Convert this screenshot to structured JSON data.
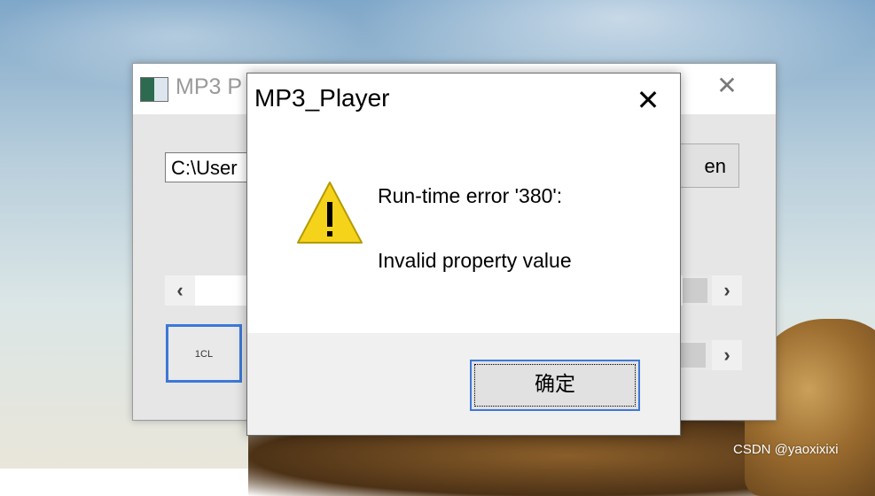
{
  "main_window": {
    "title": "MP3 P",
    "path_value": "C:\\User",
    "open_label": "en",
    "media_box_label": "1CL"
  },
  "dialog": {
    "title": "MP3_Player",
    "close_glyph": "✕",
    "message_line1": "Run-time error '380':",
    "message_line2": "Invalid property value",
    "ok_label": "确定",
    "icon": "warning-icon"
  },
  "watermark": "CSDN @yaoxixixi"
}
